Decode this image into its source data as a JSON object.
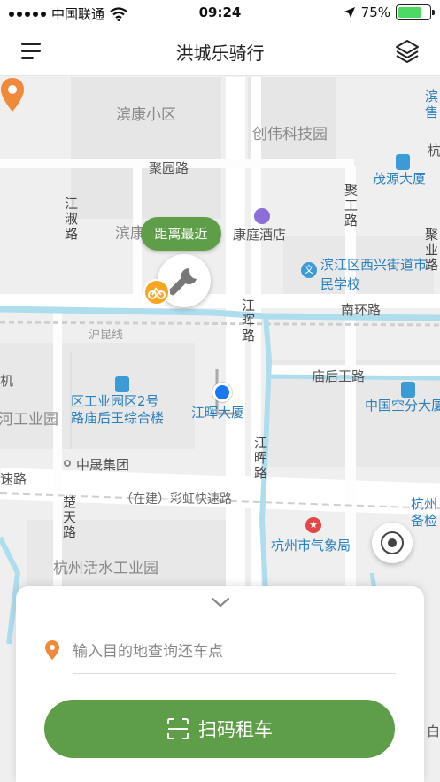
{
  "status_bar": {
    "carrier": "中国联通",
    "time": "09:24",
    "battery_percent": "75%",
    "battery_level": 0.75,
    "icons": [
      "signal-dots-icon",
      "wifi-icon",
      "location-arrow-icon",
      "battery-icon"
    ]
  },
  "nav": {
    "title": "洪城乐骑行",
    "left_icon": "menu-icon",
    "right_icon": "layers-icon"
  },
  "map": {
    "labels": {
      "binkang": "滨康小区",
      "chuangwei": "创伟科技园",
      "juyuan_rd": "聚园路",
      "jiangshu_rd": "江淑路",
      "bin_partial": "滨康",
      "kangting": "康庭酒店",
      "maoyuan": "茂源大厦",
      "jugong_rd": "聚工路",
      "juye_rd": "聚业路",
      "binjiang_school": "滨江区西兴街道市民学校",
      "nanhuan_rd": "南环路",
      "huhang_line": "沪昆线",
      "jianghui_rd_top": "江晖路",
      "miaohouwang_rd": "庙后王路",
      "industrial_park": "区工业园区2号路庙后王综合楼",
      "industrial_park_line1": "区工业园区2号",
      "industrial_park_line2": "路庙后王综合楼",
      "jianghui_bldg": "江晖大厦",
      "china_kongkong": "中国空分大厦",
      "left_ji": "机",
      "left_gongye": "河工业园",
      "zhongsheng": "中晟集团",
      "chutian_rd": "楚天路",
      "jianghui_rd_bottom": "江晖路",
      "su_rd": "速路",
      "caihong_expressway": "（在建）彩虹快速路",
      "hangzhou_weather": "杭州市气象局",
      "hangzhou_bei": "杭州备检",
      "huoshui_park": "杭州活水工业园",
      "bin_top_right": "滨售",
      "hang_right": "杭",
      "bai_right": "白"
    },
    "nearest_tag": "距离最近",
    "markers": [
      "wrench-icon",
      "bike-icon",
      "orange-pin-icon",
      "user-location-icon"
    ],
    "locate_icon": "locate-icon"
  },
  "panel": {
    "collapse_icon": "chevron-down-icon",
    "destination_placeholder": "输入目的地查询还车点",
    "scan_button": "扫码租车",
    "colors": {
      "brand_green": "#5f9e48",
      "pin_orange": "#f0893a",
      "user_blue": "#1877f2"
    }
  }
}
